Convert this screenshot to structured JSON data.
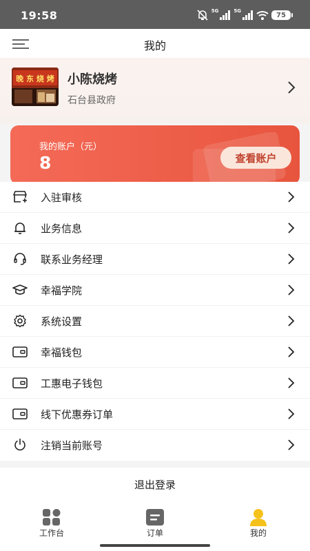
{
  "status_bar": {
    "time": "19:58",
    "signal_label_1": "5G",
    "signal_label_2": "5G",
    "battery": "75"
  },
  "header": {
    "title": "我的"
  },
  "profile": {
    "shop_name": "小陈烧烤",
    "location": "石台县政府",
    "sign_text": "晚 东 烧 烤"
  },
  "account": {
    "label": "我的账户（元）",
    "value": "8",
    "button_label": "查看账户"
  },
  "menu": {
    "items": [
      {
        "label": "入驻审核",
        "icon": "store-check-icon"
      },
      {
        "label": "业务信息",
        "icon": "bell-icon"
      },
      {
        "label": "联系业务经理",
        "icon": "headset-icon"
      },
      {
        "label": "幸福学院",
        "icon": "graduation-cap-icon"
      },
      {
        "label": "系统设置",
        "icon": "gear-icon"
      },
      {
        "label": "幸福钱包",
        "icon": "wallet-icon"
      },
      {
        "label": "工惠电子钱包",
        "icon": "wallet-icon"
      },
      {
        "label": "线下优惠券订单",
        "icon": "wallet-icon"
      },
      {
        "label": "注销当前账号",
        "icon": "power-icon"
      }
    ]
  },
  "logout": {
    "label": "退出登录"
  },
  "tabbar": {
    "tabs": [
      {
        "label": "工作台",
        "icon": "grid-icon",
        "active": false
      },
      {
        "label": "订单",
        "icon": "order-icon",
        "active": false
      },
      {
        "label": "我的",
        "icon": "user-icon",
        "active": true
      }
    ]
  },
  "colors": {
    "accent": "#e8553e",
    "active_tab": "#f5c21b",
    "text": "#222222"
  }
}
